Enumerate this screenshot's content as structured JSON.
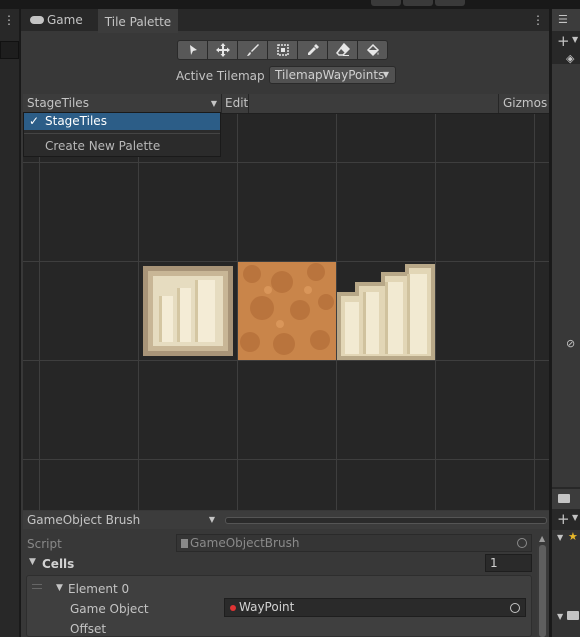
{
  "tabs": {
    "game": "Game",
    "tile_palette": "Tile Palette"
  },
  "toolbar": {
    "tools": [
      {
        "name": "select-tool",
        "icon": "arrow-icon"
      },
      {
        "name": "move-tool",
        "icon": "move-icon"
      },
      {
        "name": "paint-tool",
        "icon": "brush-icon"
      },
      {
        "name": "box-fill-tool",
        "icon": "box-icon"
      },
      {
        "name": "picker-tool",
        "icon": "eyedropper-icon"
      },
      {
        "name": "erase-tool",
        "icon": "eraser-icon"
      },
      {
        "name": "fill-tool",
        "icon": "bucket-icon"
      }
    ]
  },
  "active_tilemap": {
    "label": "Active Tilemap",
    "value": "TilemapWayPoints"
  },
  "palette_bar": {
    "palette": "StageTiles",
    "edit": "Edit",
    "gizmos": "Gizmos"
  },
  "palette_menu": {
    "selected": "StageTiles",
    "check": "✓",
    "create": "Create New Palette"
  },
  "brush": {
    "name": "GameObject Brush"
  },
  "inspector": {
    "script_label": "Script",
    "script_value": "GameObjectBrush",
    "cells_label": "Cells",
    "cells_count": "1",
    "element_label": "Element 0",
    "game_object_label": "Game Object",
    "game_object_value": "WayPoint",
    "offset_label": "Offset"
  },
  "colors": {
    "selection": "#2c5d87",
    "waypoint_dot": "#e03434",
    "tile_sand": "#c9854a",
    "tile_stone": "#e8dcbc"
  }
}
